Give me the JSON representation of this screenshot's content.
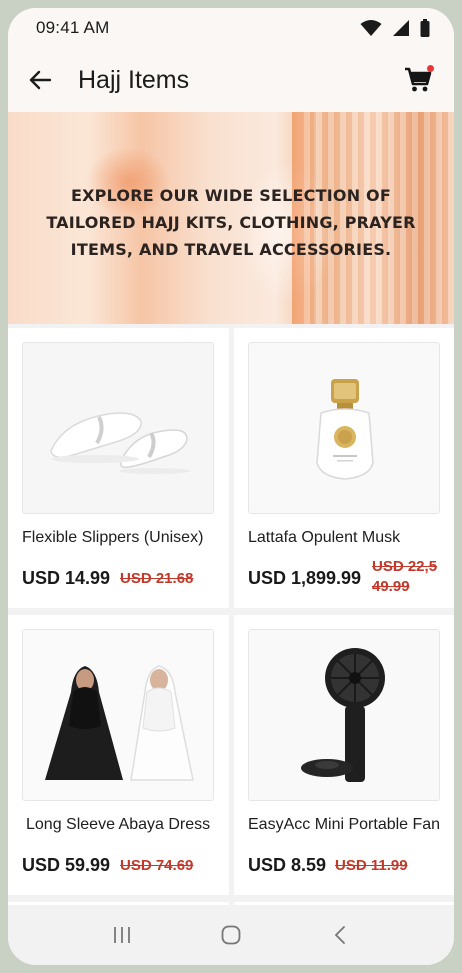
{
  "status_bar": {
    "time": "09:41 AM"
  },
  "app_bar": {
    "title": "Hajj Items"
  },
  "banner": {
    "text": "EXPLORE OUR WIDE SELECTION OF TAILORED HAJJ KITS, CLOTHING, PRAYER ITEMS, AND TRAVEL ACCESSORIES."
  },
  "products": [
    {
      "name": "Flexible Slippers (Unisex)",
      "price": "USD 14.99",
      "old_price": "USD 21.68",
      "icon": "slippers-image"
    },
    {
      "name": "Lattafa Opulent Musk",
      "price": "USD 1,899.99",
      "old_price": "USD 22,549.99",
      "old_price_line1": "USD 22,5",
      "old_price_line2": "49.99",
      "icon": "perfume-bottle-image"
    },
    {
      "name": "Long Sleeve Abaya Dress",
      "price": "USD 59.99",
      "old_price": "USD 74.69",
      "icon": "abaya-dress-image"
    },
    {
      "name": "EasyAcc Mini Portable Fan",
      "price": "USD 8.59",
      "old_price": "USD 11.99",
      "icon": "portable-fan-image"
    }
  ],
  "colors": {
    "accent_red": "#c0392b",
    "cart_badge": "#e53935",
    "app_bar_bg": "#fbf7f4"
  }
}
